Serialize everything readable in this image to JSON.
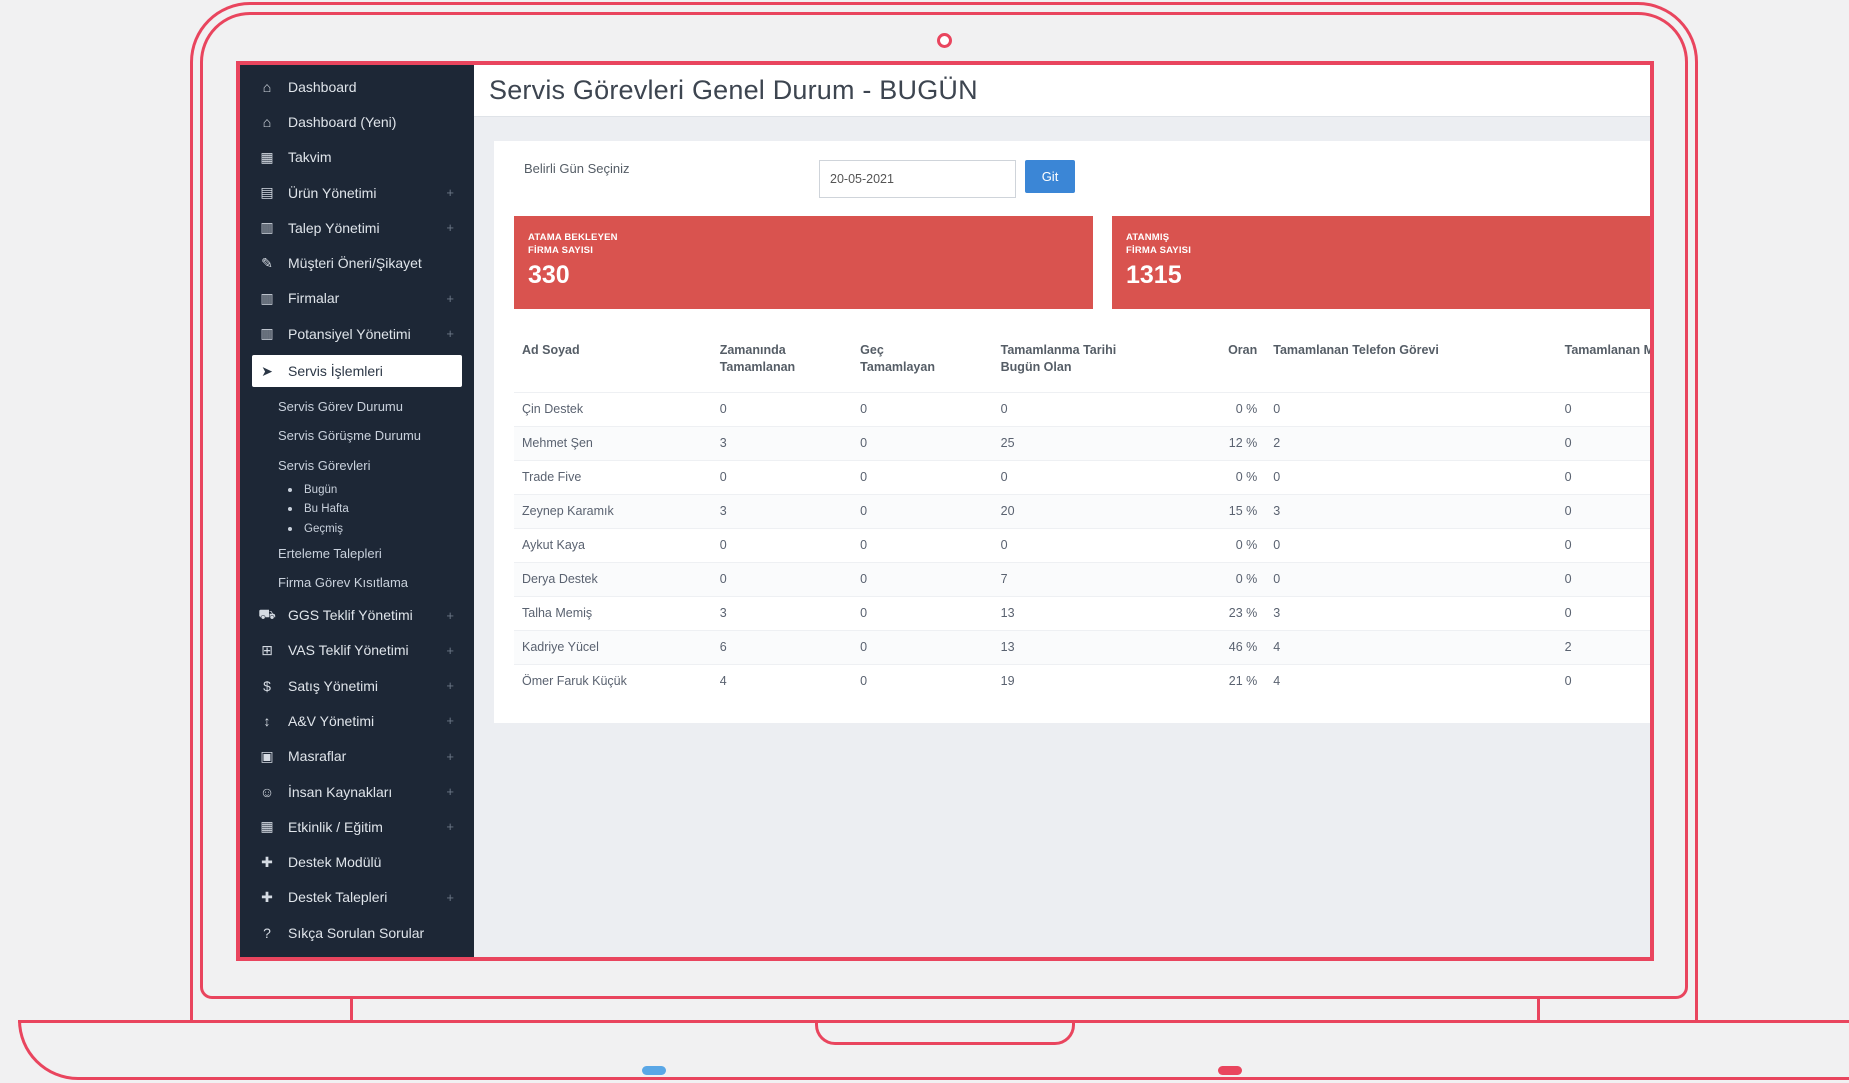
{
  "sidebar": {
    "items": [
      {
        "label": "Dashboard",
        "icon": "home-icon",
        "glyph": "⌂",
        "plus": false
      },
      {
        "label": "Dashboard (Yeni)",
        "icon": "home-icon",
        "glyph": "⌂",
        "plus": false
      },
      {
        "label": "Takvim",
        "icon": "calendar-icon",
        "glyph": "▦",
        "plus": false
      },
      {
        "label": "Ürün Yönetimi",
        "icon": "box-icon",
        "glyph": "▤",
        "plus": true
      },
      {
        "label": "Talep Yönetimi",
        "icon": "clipboard-icon",
        "glyph": "▥",
        "plus": true
      },
      {
        "label": "Müşteri Öneri/Şikayet",
        "icon": "gavel-icon",
        "glyph": "✎",
        "plus": false
      },
      {
        "label": "Firmalar",
        "icon": "building-icon",
        "glyph": "▥",
        "plus": true
      },
      {
        "label": "Potansiyel Yönetimi",
        "icon": "building-icon",
        "glyph": "▥",
        "plus": true
      }
    ],
    "active": {
      "label": "Servis İşlemleri",
      "icon": "paper-plane-icon",
      "glyph": "➤"
    },
    "sub_items": [
      "Servis Görev Durumu",
      "Servis Görüşme Durumu",
      "Servis Görevleri"
    ],
    "sub_sub_items": [
      "Bugün",
      "Bu Hafta",
      "Geçmiş"
    ],
    "sub_items_after": [
      "Erteleme Talepleri",
      "Firma Görev Kısıtlama"
    ],
    "items_after": [
      {
        "label": "GGS Teklif Yönetimi",
        "icon": "cart-icon",
        "glyph": "⛟",
        "plus": true
      },
      {
        "label": "VAS Teklif Yönetimi",
        "icon": "basket-icon",
        "glyph": "⊞",
        "plus": true
      },
      {
        "label": "Satış Yönetimi",
        "icon": "dollar-icon",
        "glyph": "$",
        "plus": true
      },
      {
        "label": "A&V Yönetimi",
        "icon": "arrows-v-icon",
        "glyph": "↕",
        "plus": true
      },
      {
        "label": "Masraflar",
        "icon": "money-icon",
        "glyph": "▣",
        "plus": true
      },
      {
        "label": "İnsan Kaynakları",
        "icon": "users-icon",
        "glyph": "☺",
        "plus": true
      },
      {
        "label": "Etkinlik / Eğitim",
        "icon": "calendar-icon",
        "glyph": "▦",
        "plus": true
      },
      {
        "label": "Destek Modülü",
        "icon": "medkit-icon",
        "glyph": "✚",
        "plus": false
      },
      {
        "label": "Destek Talepleri",
        "icon": "medkit-icon",
        "glyph": "✚",
        "plus": true
      },
      {
        "label": "Sıkça Sorulan Sorular",
        "icon": "question-icon",
        "glyph": "?",
        "plus": false
      }
    ]
  },
  "header": {
    "title": "Servis Görevleri Genel Durum - BUGÜN"
  },
  "filter": {
    "label": "Belirli Gün Seçiniz",
    "date_value": "20-05-2021",
    "go_label": "Git"
  },
  "stats": [
    {
      "label_line1": "ATAMA BEKLEYEN",
      "label_line2": "FİRMA SAYISI",
      "value": "330"
    },
    {
      "label_line1": "ATANMIŞ",
      "label_line2": "FİRMA SAYISI",
      "value": "1315"
    }
  ],
  "table": {
    "headers": [
      [
        "Ad Soyad"
      ],
      [
        "Zamanında",
        "Tamamlanan"
      ],
      [
        "Geç",
        "Tamamlayan"
      ],
      [
        "Tamamlanma Tarihi",
        "Bugün Olan"
      ],
      [
        "Oran"
      ],
      [
        "Tamamlanan Telefon Görevi"
      ],
      [
        "Tamamlanan Mail Gör"
      ]
    ],
    "rows": [
      [
        "Çin Destek",
        "0",
        "0",
        "0",
        "0 %",
        "0",
        "0"
      ],
      [
        "Mehmet Şen",
        "3",
        "0",
        "25",
        "12 %",
        "2",
        "0"
      ],
      [
        "Trade Five",
        "0",
        "0",
        "0",
        "0 %",
        "0",
        "0"
      ],
      [
        "Zeynep Karamık",
        "3",
        "0",
        "20",
        "15 %",
        "3",
        "0"
      ],
      [
        "Aykut Kaya",
        "0",
        "0",
        "0",
        "0 %",
        "0",
        "0"
      ],
      [
        "Derya Destek",
        "0",
        "0",
        "7",
        "0 %",
        "0",
        "0"
      ],
      [
        "Talha Memiş",
        "3",
        "0",
        "13",
        "23 %",
        "3",
        "0"
      ],
      [
        "Kadriye Yücel",
        "6",
        "0",
        "13",
        "46 %",
        "4",
        "2"
      ],
      [
        "Ömer Faruk Küçük",
        "4",
        "0",
        "19",
        "21 %",
        "4",
        "0"
      ]
    ]
  },
  "colors": {
    "frame": "#e9455e",
    "sidebar": "#1d2736",
    "stat": "#d9534f",
    "button": "#3b86d6"
  }
}
